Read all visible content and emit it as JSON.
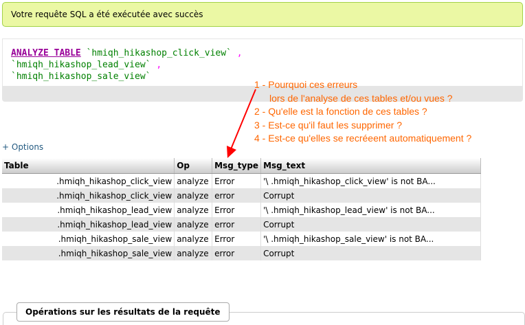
{
  "success_message": "Votre requête SQL a été exécutée avec succès",
  "sql": {
    "keyword": "ANALYZE TABLE",
    "tables": [
      "`hmiqh_hikashop_click_view`",
      "`hmiqh_hikashop_lead_view`",
      "`hmiqh_hikashop_sale_view`"
    ],
    "separator": ","
  },
  "annotation": {
    "color": "#ff6600",
    "lines": [
      "1 - Pourquoi ces erreurs",
      "lors de l'analyse de ces tables et/ou vues ?",
      "2 - Qu'elle est la fonction de ces tables ?",
      "3 - Est-ce qu'il faut les supprimer ?",
      "4 - Est-ce qu'elles se recréeent automatiquement ?"
    ]
  },
  "options_link": "+ Options",
  "results": {
    "headers": [
      "Table",
      "Op",
      "Msg_type",
      "Msg_text"
    ],
    "rows": [
      {
        "table": ".hmiqh_hikashop_click_view",
        "op": "analyze",
        "msg_type": "Error",
        "msg_text": "'\\                  .hmiqh_hikashop_click_view' is not BA..."
      },
      {
        "table": ".hmiqh_hikashop_click_view",
        "op": "analyze",
        "msg_type": "error",
        "msg_text": "Corrupt"
      },
      {
        "table": ".hmiqh_hikashop_lead_view",
        "op": "analyze",
        "msg_type": "Error",
        "msg_text": "'\\                  .hmiqh_hikashop_lead_view' is not BA..."
      },
      {
        "table": ".hmiqh_hikashop_lead_view",
        "op": "analyze",
        "msg_type": "error",
        "msg_text": "Corrupt"
      },
      {
        "table": ".hmiqh_hikashop_sale_view",
        "op": "analyze",
        "msg_type": "Error",
        "msg_text": "'\\                  .hmiqh_hikashop_sale_view' is not BA..."
      },
      {
        "table": ".hmiqh_hikashop_sale_view",
        "op": "analyze",
        "msg_type": "error",
        "msg_text": "Corrupt"
      }
    ]
  },
  "query_operations_label": "Opérations sur les résultats de la requête",
  "colors": {
    "success_bg": "#ebf8a4",
    "success_border": "#a2d246",
    "sql_keyword": "#990099",
    "sql_table": "#008000",
    "link": "#235a81"
  }
}
